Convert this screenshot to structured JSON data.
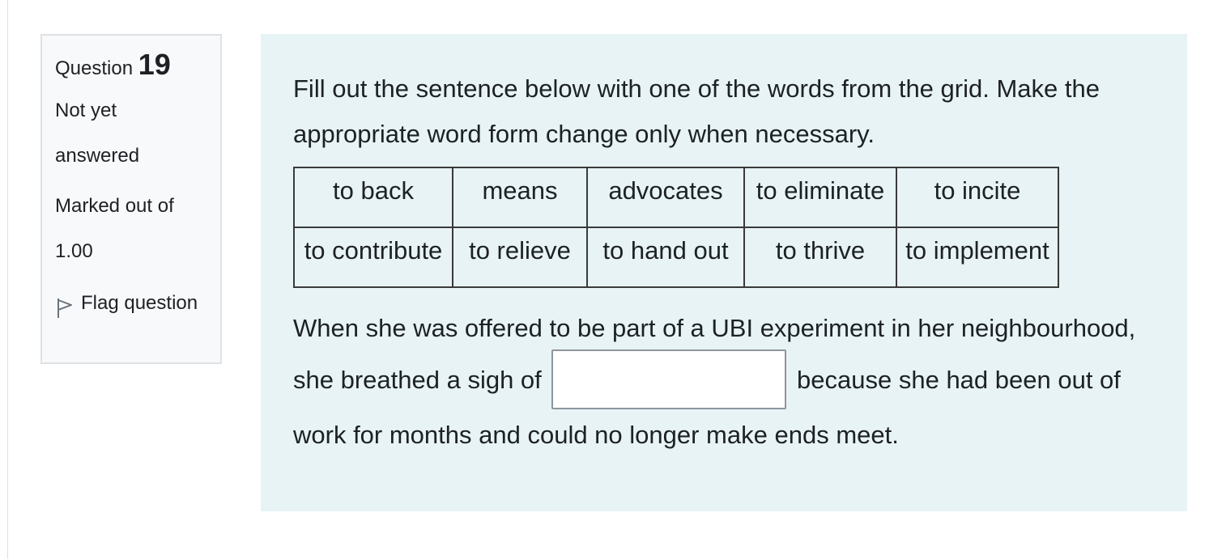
{
  "question_info": {
    "prefix": "Question",
    "number": "19",
    "state_line1": "Not yet",
    "state_line2": "answered",
    "grade_line1": "Marked out of",
    "grade_line2": "1.00",
    "flag_label": "Flag question"
  },
  "prompt": "Fill out the sentence below with one of the words from the grid. Make the appropriate word form change only when necessary.",
  "grid": {
    "rows": [
      [
        "to back",
        "means",
        "advocates",
        "to eliminate",
        "to incite"
      ],
      [
        "to contribute",
        "to relieve",
        "to hand out",
        "to thrive",
        "to implement"
      ]
    ]
  },
  "sentence": {
    "before": "When she was offered to be part of a UBI experiment in her neighbourhood, she breathed a sigh of",
    "after": "because she had been out of work for months and could no longer make ends meet.",
    "answer_value": ""
  },
  "colors": {
    "content_background": "#e7f3f5",
    "info_background": "#f8f9fa",
    "border": "#dee2e6"
  },
  "icons": {
    "flag": "flag-outline-icon"
  }
}
